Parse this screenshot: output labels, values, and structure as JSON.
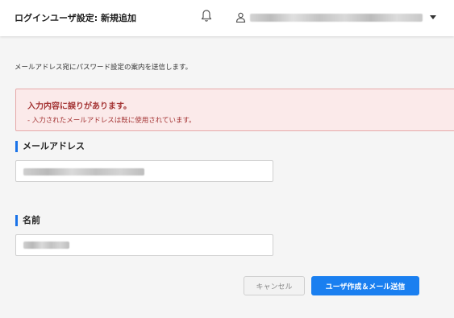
{
  "header": {
    "title": "ログインユーザ設定: 新規追加",
    "user_email": "",
    "icons": [
      "bell-icon",
      "user-icon",
      "caret-down-icon"
    ]
  },
  "main": {
    "description": "メールアドレス宛にパスワード設定の案内を送信します。",
    "error": {
      "title": "入力内容に誤りがあります。",
      "items": [
        "-  入力されたメールアドレスは既に使用されています。"
      ]
    },
    "fields": {
      "email": {
        "label": "メールアドレス",
        "value": ""
      },
      "name": {
        "label": "名前",
        "value": ""
      }
    },
    "buttons": {
      "cancel": "キャンセル",
      "submit": "ユーザ作成＆メール送信"
    }
  },
  "colors": {
    "accent": "#1a7ff0",
    "label_bar": "#1a73e8",
    "error_text": "#a33232",
    "error_bg": "#fbeaea",
    "error_border": "#e6a9a9",
    "page_bg": "#f5f5f5"
  }
}
